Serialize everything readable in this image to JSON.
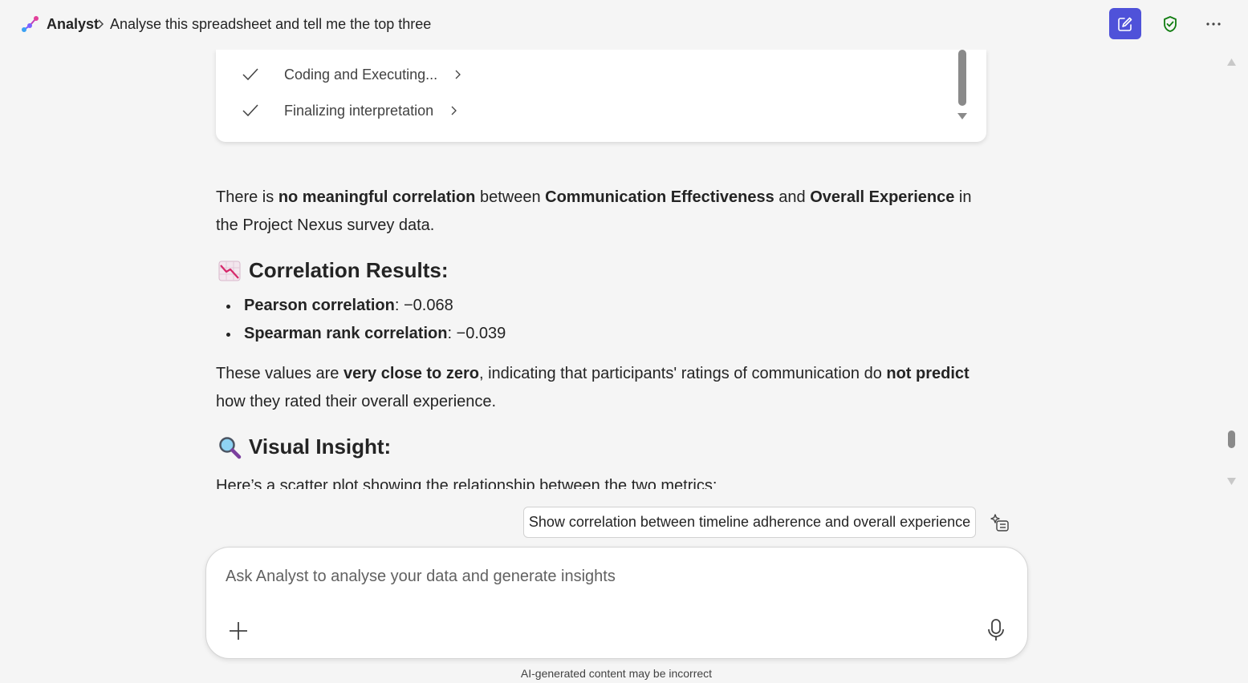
{
  "header": {
    "app_name": "Analyst",
    "breadcrumb_title": "Analyse this spreadsheet and tell me the top three",
    "new_chat_icon": "compose-icon",
    "shield_icon": "shield-check-icon",
    "more_icon": "more-horizontal-icon",
    "accent_color": "#4f52d9"
  },
  "steps": [
    {
      "label": "Coding and Executing...",
      "status": "done"
    },
    {
      "label": "Finalizing interpretation",
      "status": "done"
    }
  ],
  "response": {
    "intro": {
      "t1": "There is ",
      "b1": "no meaningful correlation",
      "t2": " between ",
      "b2": "Communication Effectiveness",
      "t3": " and ",
      "b3": "Overall Experience",
      "t4": " in the Project Nexus survey data."
    },
    "results_heading": "Correlation Results:",
    "results": [
      {
        "label": "Pearson correlation",
        "value": ": −0.068"
      },
      {
        "label": "Spearman rank correlation",
        "value": ": −0.039"
      }
    ],
    "summary": {
      "t1": "These values are ",
      "b1": "very close to zero",
      "t2": ", indicating that participants' ratings of communication do ",
      "b2": "not predict",
      "t3": " how they rated their overall experience."
    },
    "insight_heading": "Visual Insight:",
    "insight_text": "Here’s a scatter plot showing the relationship between the two metrics:"
  },
  "suggestion": {
    "label": "Show correlation between timeline adherence and overall experience"
  },
  "composer": {
    "placeholder": "Ask Analyst to analyse your data and generate insights",
    "value": ""
  },
  "disclaimer": "AI-generated content may be incorrect"
}
